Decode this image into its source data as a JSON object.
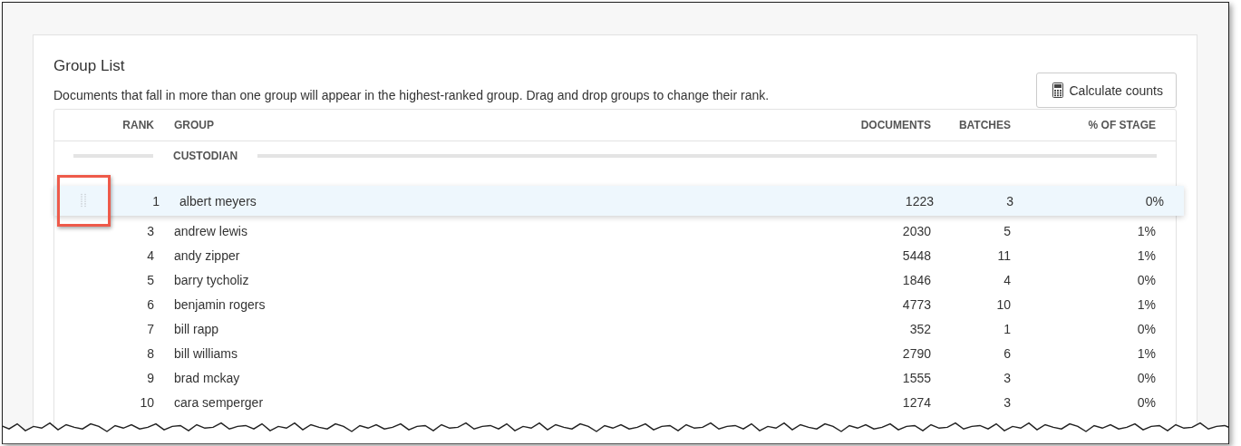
{
  "card": {
    "title": "Group List",
    "description": "Documents that fall in more than one group will appear in the highest-ranked group. Drag and drop groups to change their rank.",
    "calculate_button": "Calculate counts"
  },
  "table": {
    "columns": [
      "RANK",
      "GROUP",
      "DOCUMENTS",
      "BATCHES",
      "% OF STAGE"
    ],
    "section": "CUSTODIAN",
    "dragging": {
      "rank": "1",
      "group": "albert meyers",
      "documents": "1223",
      "batches": "3",
      "percent": "0%",
      "highlighted": true
    },
    "rows": [
      {
        "rank": "3",
        "group": "andrew lewis",
        "documents": "2030",
        "batches": "5",
        "percent": "1%"
      },
      {
        "rank": "4",
        "group": "andy zipper",
        "documents": "5448",
        "batches": "11",
        "percent": "1%"
      },
      {
        "rank": "5",
        "group": "barry tycholiz",
        "documents": "1846",
        "batches": "4",
        "percent": "0%"
      },
      {
        "rank": "6",
        "group": "benjamin rogers",
        "documents": "4773",
        "batches": "10",
        "percent": "1%"
      },
      {
        "rank": "7",
        "group": "bill rapp",
        "documents": "352",
        "batches": "1",
        "percent": "0%"
      },
      {
        "rank": "8",
        "group": "bill williams",
        "documents": "2790",
        "batches": "6",
        "percent": "1%"
      },
      {
        "rank": "9",
        "group": "brad mckay",
        "documents": "1555",
        "batches": "3",
        "percent": "0%"
      },
      {
        "rank": "10",
        "group": "cara semperger",
        "documents": "1274",
        "batches": "3",
        "percent": "0%"
      }
    ]
  }
}
